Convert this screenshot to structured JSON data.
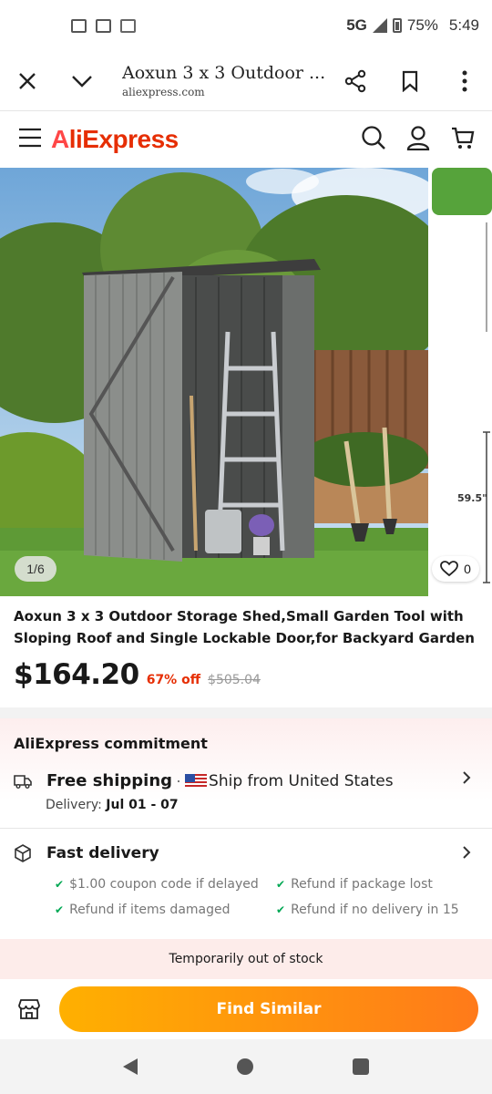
{
  "status_bar": {
    "network": "5G",
    "battery": "75%",
    "time": "5:49",
    "icons": [
      "message-icon",
      "gallery-icon",
      "gmail-icon"
    ]
  },
  "browser": {
    "page_title": "Aoxun 3 x 3 Outdoor ...",
    "domain": "aliexpress.com"
  },
  "site": {
    "logo_text": "AliExpress",
    "brand_color": "#e62e04"
  },
  "gallery": {
    "counter": "1/6",
    "likes": "0",
    "side_label": "59.5\""
  },
  "product": {
    "title": "Aoxun 3 x 3 Outdoor Storage Shed,Small Garden Tool with Sloping Roof and Single Lockable Door,for Backyard Garden",
    "price": "$164.20",
    "discount": "67% off",
    "old_price": "$505.04"
  },
  "commitment": {
    "title": "AliExpress commitment",
    "free_shipping": "Free shipping",
    "separator": "·",
    "ship_from": "Ship from United States",
    "delivery_label": "Delivery:",
    "delivery_dates": "Jul 01 - 07",
    "fast_delivery": "Fast delivery",
    "guarantees": [
      "$1.00 coupon code if delayed",
      "Refund if package lost",
      "Refund if items damaged",
      "Refund if no delivery in 15"
    ]
  },
  "stock_notice": "Temporarily out of stock",
  "actions": {
    "find_similar": "Find Similar"
  }
}
